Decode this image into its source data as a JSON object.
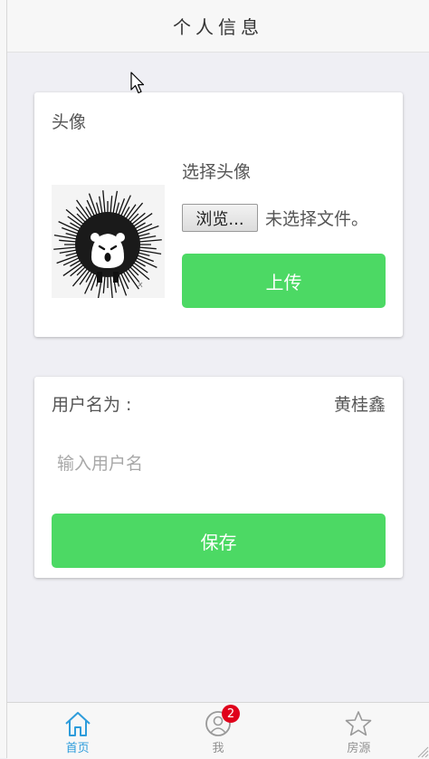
{
  "header": {
    "title": "个人信息"
  },
  "avatar_section": {
    "title": "头像",
    "choose_label": "选择头像",
    "browse_label": "浏览...",
    "file_status": "未选择文件。",
    "upload_label": "上传"
  },
  "user_section": {
    "username_label": "用户名为 :",
    "username_value": "黄桂鑫",
    "input_placeholder": "输入用户名",
    "save_label": "保存"
  },
  "tabbar": {
    "tabs": [
      {
        "label": "首页",
        "icon": "home-icon",
        "active": true
      },
      {
        "label": "我",
        "icon": "user-icon",
        "badge": "2"
      },
      {
        "label": "房源",
        "icon": "star-icon"
      }
    ]
  },
  "colors": {
    "accent_green": "#4cd964",
    "tab_active": "#2d9cdb",
    "badge_red": "#e0001b"
  }
}
